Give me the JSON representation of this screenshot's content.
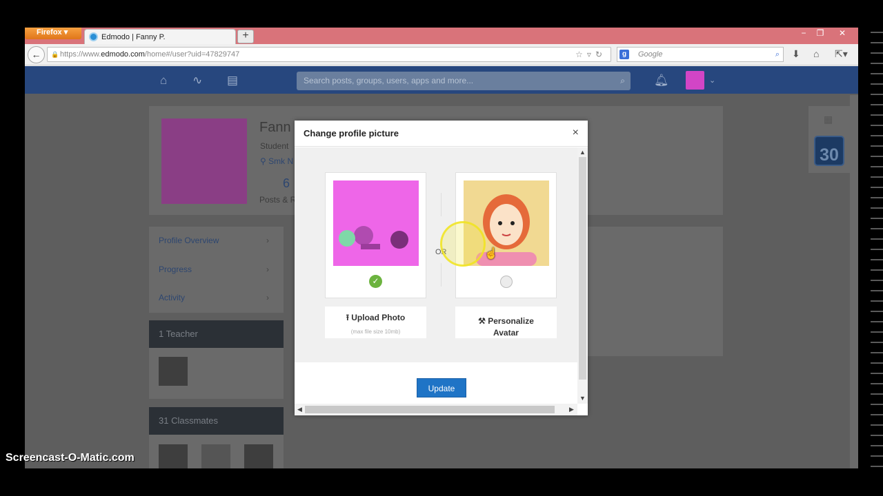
{
  "browser": {
    "app_button": "Firefox",
    "tab_title": "Edmodo | Fanny P.",
    "url_prefix": "https://www.",
    "url_domain": "edmodo.com",
    "url_path": "/home#/user?uid=47829747",
    "search_placeholder": "Google"
  },
  "header": {
    "search_placeholder": "Search posts, groups, users, apps and more..."
  },
  "profile": {
    "name": "Fann",
    "role": "Student",
    "school": "Smk N",
    "count": "6",
    "count_label": "Posts & R"
  },
  "sidebar": {
    "items": [
      {
        "label": "Profile Overview"
      },
      {
        "label": "Progress"
      },
      {
        "label": "Activity"
      }
    ],
    "teachers_header": "1 Teacher",
    "classmates_header": "31 Classmates"
  },
  "calendar": {
    "day": "30"
  },
  "modal": {
    "title": "Change profile picture",
    "close_label": "×",
    "or_label": "OR",
    "upload_label": "Upload Photo",
    "upload_sub": "(max file size 10mb)",
    "avatar_label_1": "Personalize",
    "avatar_label_2": "Avatar",
    "update_label": "Update",
    "selected_option": "photo"
  },
  "watermark": "Screencast-O-Matic.com",
  "colors": {
    "edmodo_header": "#27477e",
    "update_button": "#1f74c6",
    "check": "#6cb33f"
  }
}
